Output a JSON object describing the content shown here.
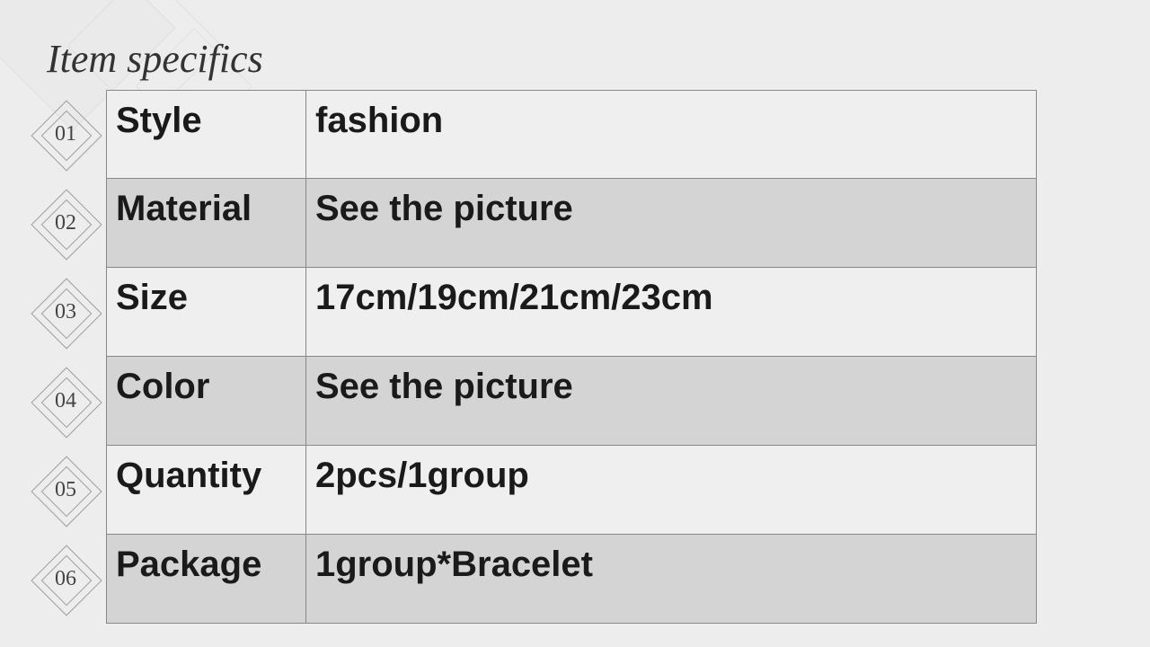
{
  "title": "Item specifics",
  "rows": [
    {
      "num": "01",
      "label": "Style",
      "value": "fashion"
    },
    {
      "num": "02",
      "label": "Material",
      "value": "See the picture"
    },
    {
      "num": "03",
      "label": "Size",
      "value": "17cm/19cm/21cm/23cm"
    },
    {
      "num": "04",
      "label": "Color",
      "value": "See the picture"
    },
    {
      "num": "05",
      "label": "Quantity",
      "value": "2pcs/1group"
    },
    {
      "num": "06",
      "label": "Package",
      "value": "1group*Bracelet"
    }
  ]
}
